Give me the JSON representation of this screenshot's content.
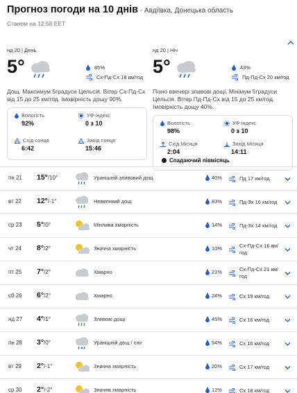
{
  "header": {
    "title": "Прогноз погоди на 10 днів",
    "location": " - Авдіївка, Донецька область",
    "as_of": "Станом на 12:58 EET"
  },
  "day_card": {
    "date": "нд 20 | День",
    "temp": "5°",
    "icon": "rain-cloud-icon",
    "humidity_pct": "85%",
    "wind": "Сх-Пд-Сх 18 км/год",
    "description": "Дощ. Максимум 5градуси Цельсія. Вітер Сх-Пд-Сх від 15 до 25 км/год. Імовірність дощу 90%.",
    "humidity_label": "Вологість",
    "humidity_value": "92%",
    "uv_label": "УФ-індекс",
    "uv_value": "0 з 10",
    "sunrise_label": "Схід сонця",
    "sunrise_value": "6:42",
    "sunset_label": "Захід сонця",
    "sunset_value": "15:46"
  },
  "night_card": {
    "date": "нд 20 | Ніч",
    "temp": "5°",
    "icon": "night-rain-cloud-icon",
    "humidity_pct": "43%",
    "wind": "Пд-Пд-Сх 20 км/год",
    "description": "Пізно ввечері зливові дощі. Мінімум 5градуси Цельсія. Вітер Пд-Пд-Сх від 15 до 25 км/год. Імовірність дощу 40%.",
    "humidity_label": "Вологість",
    "humidity_value": "98%",
    "uv_label": "УФ-індекс",
    "uv_value": "0 з 10",
    "moonrise_label": "Схід Місяця",
    "moonrise_value": "2:04",
    "moonset_label": "Захід Місяця",
    "moonset_value": "14:11",
    "moon_phase": "Спадаючий півмісяць"
  },
  "forecast": [
    {
      "date": "пн 21",
      "high": "15°",
      "low": "/10°",
      "icon": "rain-cloud-icon",
      "desc": "Уранішній зливовий дощ",
      "precip": "40%",
      "wind": "Пд 17 км/год"
    },
    {
      "date": "вт 22",
      "high": "12°",
      "low": "/-1°",
      "icon": "rain-cloud-icon",
      "desc": "Невеликий дощ",
      "precip": "83%",
      "wind": "Пд-Зх 16 км/год"
    },
    {
      "date": "ср 23",
      "high": "5°",
      "low": "/0°",
      "icon": "partly-cloudy-icon",
      "desc": "Мінлива хмарність",
      "precip": "14%",
      "wind": "Пд-Зх 14 км/год"
    },
    {
      "date": "чт 24",
      "high": "8°",
      "low": "/2°",
      "icon": "partly-cloudy-icon",
      "desc": "Значна хмарність",
      "precip": "10%",
      "wind": "Сх-Пд-Сх 16 км/год"
    },
    {
      "date": "пт 25",
      "high": "7°",
      "low": "/2°",
      "icon": "cloud-icon",
      "desc": "Хмарно",
      "precip": "21%",
      "wind": "Сх-Пд-Сх 21 км/год"
    },
    {
      "date": "сб 26",
      "high": "6°",
      "low": "/2°",
      "icon": "cloud-icon",
      "desc": "Хмарно",
      "precip": "24%",
      "wind": "Сх 19 км/год"
    },
    {
      "date": "нд 27",
      "high": "4°",
      "low": "/1°",
      "icon": "rain-cloud-icon",
      "desc": "Зливові дощі",
      "precip": "45%",
      "wind": "Сх 16 км/год"
    },
    {
      "date": "пн 28",
      "high": "3°",
      "low": "/0°",
      "icon": "rain-snow-icon",
      "desc": "Уранішній дощ / сніг",
      "precip": "54%",
      "wind": "Сх 16 км/год"
    },
    {
      "date": "вт 29",
      "high": "2°",
      "low": "/-1°",
      "icon": "partly-cloudy-icon",
      "desc": "Значна хмарність",
      "precip": "20%",
      "wind": "Сх 17 км/год"
    },
    {
      "date": "ср 30",
      "high": "2°",
      "low": "/-2°",
      "icon": "partly-cloudy-icon",
      "desc": "Значна хмарність",
      "precip": "12%",
      "wind": "Сх 18 км/год"
    }
  ],
  "colors": {
    "accent": "#1b5bd6",
    "sun": "#f3c21b",
    "cloud": "#c8ccd1"
  }
}
